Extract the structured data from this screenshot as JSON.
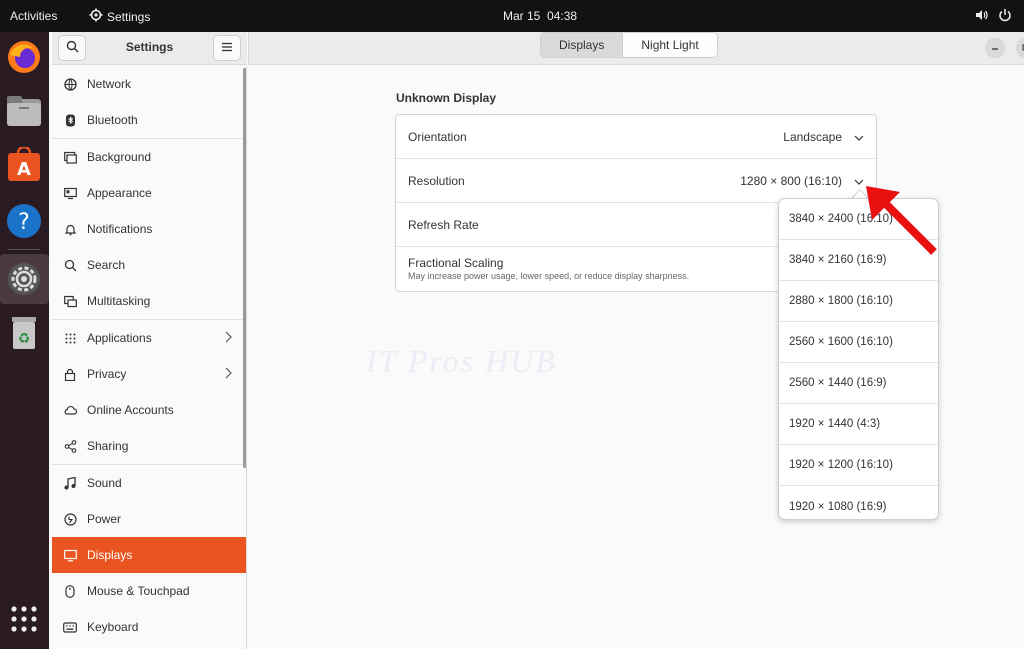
{
  "topbar": {
    "activities": "Activities",
    "app_name": "Settings",
    "date": "Mar 15",
    "time": "04:38"
  },
  "dock": {
    "icons": [
      "firefox-icon",
      "files-icon",
      "software-center-icon",
      "help-icon",
      "settings-icon",
      "trash-icon",
      "app-grid-icon"
    ]
  },
  "sidebar": {
    "title": "Settings",
    "items": [
      {
        "label": "Network",
        "icon": "network-icon"
      },
      {
        "label": "Bluetooth",
        "icon": "bluetooth-icon"
      },
      {
        "label": "Background",
        "icon": "background-icon"
      },
      {
        "label": "Appearance",
        "icon": "appearance-icon"
      },
      {
        "label": "Notifications",
        "icon": "bell-icon"
      },
      {
        "label": "Search",
        "icon": "search-icon"
      },
      {
        "label": "Multitasking",
        "icon": "multitasking-icon"
      },
      {
        "label": "Applications",
        "icon": "grid-icon",
        "chevron": true
      },
      {
        "label": "Privacy",
        "icon": "lock-icon",
        "chevron": true
      },
      {
        "label": "Online Accounts",
        "icon": "cloud-icon"
      },
      {
        "label": "Sharing",
        "icon": "share-icon"
      },
      {
        "label": "Sound",
        "icon": "music-note-icon"
      },
      {
        "label": "Power",
        "icon": "power-icon"
      },
      {
        "label": "Displays",
        "icon": "display-icon",
        "active": true
      },
      {
        "label": "Mouse & Touchpad",
        "icon": "mouse-icon"
      },
      {
        "label": "Keyboard",
        "icon": "keyboard-icon"
      }
    ]
  },
  "header": {
    "tabs": [
      {
        "label": "Displays",
        "active": true
      },
      {
        "label": "Night Light",
        "active": false
      }
    ]
  },
  "main": {
    "display_title": "Unknown Display",
    "rows": [
      {
        "label": "Orientation",
        "value": "Landscape"
      },
      {
        "label": "Resolution",
        "value": "1280 × 800 (16:10)"
      },
      {
        "label": "Refresh Rate",
        "value": ""
      },
      {
        "label": "Fractional Scaling",
        "value": "",
        "subtitle": "May increase power usage, lower speed, or reduce display sharpness."
      }
    ],
    "watermark": "IT Pros HUB"
  },
  "resolution_dropdown": {
    "options": [
      "3840 × 2400 (16:10)",
      "3840 × 2160 (16:9)",
      "2880 × 1800 (16:10)",
      "2560 × 1600 (16:10)",
      "2560 × 1440 (16:9)",
      "1920 × 1440 (4:3)",
      "1920 × 1200 (16:10)",
      "1920 × 1080 (16:9)"
    ]
  },
  "colors": {
    "accent": "#e95420",
    "topbar": "#121212",
    "dock": "#2a1a22",
    "annotation_arrow": "#e81010"
  }
}
